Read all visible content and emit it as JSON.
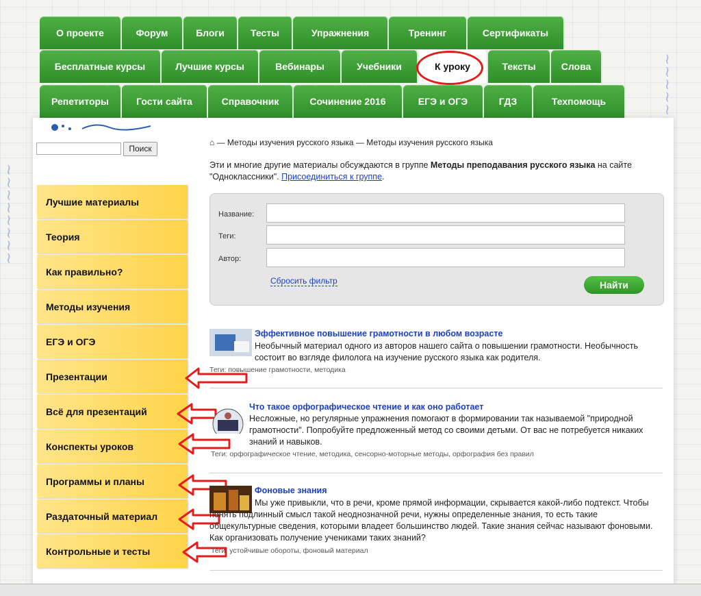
{
  "nav": {
    "row1": [
      "О проекте",
      "Форум",
      "Блоги",
      "Тесты",
      "Упражнения",
      "Тренинг",
      "Сертификаты"
    ],
    "row2": [
      "Бесплатные курсы",
      "Лучшие курсы",
      "Вебинары",
      "Учебники",
      "К уроку",
      "Тексты",
      "Слова"
    ],
    "row3": [
      "Репетиторы",
      "Гости сайта",
      "Справочник",
      "Сочинение 2016",
      "ЕГЭ и ОГЭ",
      "ГДЗ",
      "Техпомощь"
    ]
  },
  "search": {
    "button": "Поиск"
  },
  "sidebar": {
    "items": [
      "Лучшие материалы",
      "Теория",
      "Как правильно?",
      "Методы изучения",
      "ЕГЭ и ОГЭ",
      "Презентации",
      "Всё для презентаций",
      "Конспекты уроков",
      "Программы и планы",
      "Раздаточный материал",
      "Контрольные и тесты"
    ]
  },
  "breadcrumb": "⌂ — Методы изучения русского языка — Методы изучения русского языка",
  "intro": {
    "before": "Эти и многие другие материалы обсуждаются в группе ",
    "group": "Методы преподавания русского языка",
    "after": " на сайте \"Одноклассники\". ",
    "link": "Присоединиться к группе",
    "end": "."
  },
  "filter": {
    "name_label": "Название:",
    "tags_label": "Теги:",
    "author_label": "Автор:",
    "reset": "Сбросить фильтр",
    "find": "Найти"
  },
  "articles": [
    {
      "title": "Эффективное повышение грамотности в любом возрасте",
      "desc": "Необычный материал одного из авторов нашего сайта о повышении грамотности. Необычность состоит во взгляде филолога на изучение русского языка как родителя.",
      "tags": "Теги: повышение грамотности, методика"
    },
    {
      "title": "Что такое орфографическое чтение и как оно работает",
      "desc": "Несложные, но регулярные упражнения помогают в формировании так называемой \"природной грамотности\". Попробуйте предложенный метод со своими детьми. От вас не потребуется никаких знаний и навыков.",
      "tags": "Теги: орфографическое чтение, методика, сенсорно-моторные методы, орфография без правил"
    },
    {
      "title": "Фоновые знания",
      "desc": "Мы уже привыкли, что в речи, кроме прямой информации, скрывается какой-либо подтекст. Чтобы понять подлинный смысл такой неоднозначной речи, нужны определенные знания, то есть такие общекультурные сведения, которыми владеет большинство людей. Такие знания сейчас называют фоновыми. Как организовать получение учениками таких знаний?",
      "tags": "Теги: устойчивые обороты, фоновый материал"
    }
  ],
  "colors": {
    "green": "#3a9f32",
    "yellow": "#ffd34a",
    "link": "#1b3fc2",
    "arrow": "#e31c1c"
  }
}
